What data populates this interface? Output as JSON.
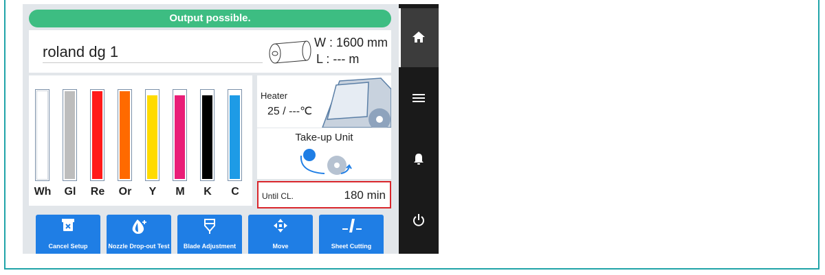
{
  "status_message": "Output possible.",
  "printer_name": "roland dg 1",
  "media": {
    "width_label": "W",
    "width_value": ": 1600 mm",
    "length_label": "L",
    "length_value": ": --- m"
  },
  "inks": [
    {
      "label": "Wh",
      "color": "#ffffff",
      "level": 1.0
    },
    {
      "label": "Gl",
      "color": "#bdbdbd",
      "level": 1.0
    },
    {
      "label": "Re",
      "color": "#ff1a1a",
      "level": 1.0
    },
    {
      "label": "Or",
      "color": "#ff6a00",
      "level": 1.0
    },
    {
      "label": "Y",
      "color": "#ffdb00",
      "level": 0.95
    },
    {
      "label": "M",
      "color": "#e91e78",
      "level": 0.95
    },
    {
      "label": "K",
      "color": "#000000",
      "level": 0.95
    },
    {
      "label": "C",
      "color": "#1e9be6",
      "level": 0.95
    }
  ],
  "heater": {
    "title": "Heater",
    "value": "25 / ---℃"
  },
  "takeup": {
    "title": "Take-up Unit"
  },
  "until_cl": {
    "label": "Until CL.",
    "value": "180 min"
  },
  "actions": [
    {
      "label": "Cancel Setup",
      "icon": "cancel-setup-icon"
    },
    {
      "label": "Nozzle Drop-out Test",
      "icon": "nozzle-test-icon"
    },
    {
      "label": "Blade Adjustment",
      "icon": "blade-icon"
    },
    {
      "label": "Move",
      "icon": "move-icon"
    },
    {
      "label": "Sheet Cutting",
      "icon": "sheet-cutting-icon"
    }
  ],
  "sidebar": [
    "home-icon",
    "menu-icon",
    "bell-icon",
    "power-icon"
  ],
  "colors": {
    "status": "#3dbd82",
    "action": "#1f7ee5",
    "sidebar": "#1a1a1a",
    "frame": "#1fa3a8",
    "highlight": "#d9252a"
  }
}
